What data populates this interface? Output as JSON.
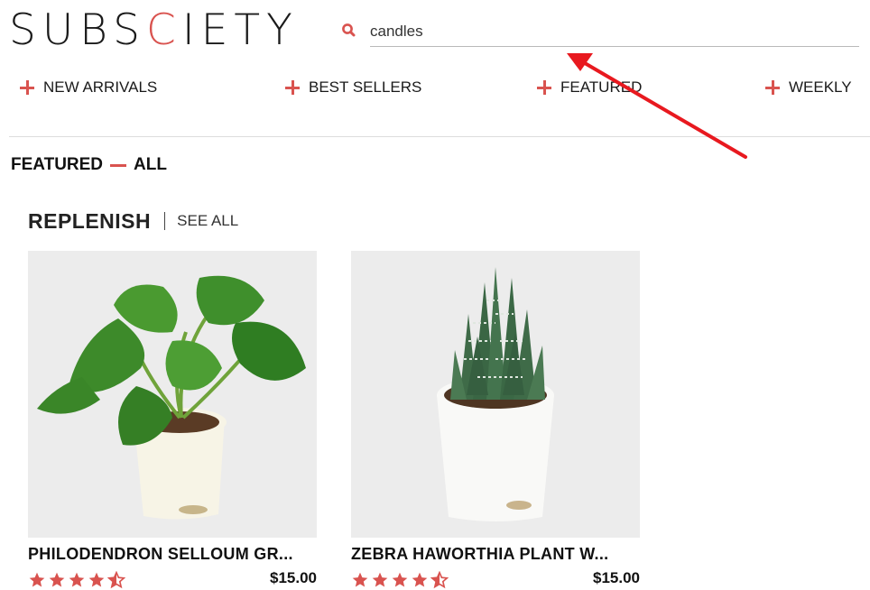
{
  "header": {
    "logo_parts": [
      "SUBS",
      "C",
      "IETY"
    ],
    "search": {
      "value": "candles",
      "icon": "search-icon"
    }
  },
  "nav": {
    "items": [
      {
        "label": "NEW ARRIVALS",
        "icon": "plus-icon"
      },
      {
        "label": "BEST SELLERS",
        "icon": "plus-icon"
      },
      {
        "label": "FEATURED",
        "icon": "plus-icon"
      },
      {
        "label": "WEEKLY",
        "icon": "plus-icon"
      }
    ]
  },
  "breadcrumb": {
    "first": "FEATURED",
    "second": "ALL"
  },
  "section": {
    "title": "REPLENISH",
    "see_all": "SEE ALL"
  },
  "products": [
    {
      "name": "PHILODENDRON SELLOUM GR...",
      "price": "$15.00",
      "rating": 4.5
    },
    {
      "name": "ZEBRA HAWORTHIA PLANT W...",
      "price": "$15.00",
      "rating": 4.5
    }
  ],
  "colors": {
    "accent": "#d9534f",
    "arrow": "#e8191f",
    "text": "#111111"
  }
}
